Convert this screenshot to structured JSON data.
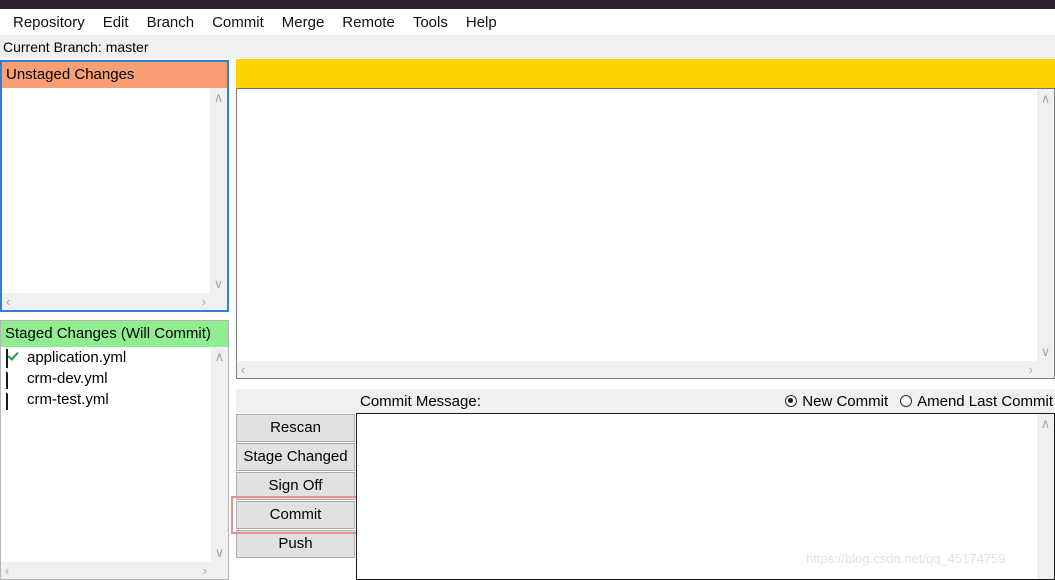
{
  "window": {
    "titlebar_color": "#2b1e2e"
  },
  "menubar": {
    "items": [
      {
        "label": "Repository"
      },
      {
        "label": "Edit"
      },
      {
        "label": "Branch"
      },
      {
        "label": "Commit"
      },
      {
        "label": "Merge"
      },
      {
        "label": "Remote"
      },
      {
        "label": "Tools"
      },
      {
        "label": "Help"
      }
    ]
  },
  "branch_bar": {
    "text": "Current Branch: master"
  },
  "unstaged": {
    "header": "Unstaged Changes",
    "header_color": "#fa9e73",
    "files": []
  },
  "staged": {
    "header": "Staged Changes (Will Commit)",
    "header_color": "#90ee90",
    "files": [
      {
        "name": "application.yml",
        "icon": "checked-box-icon",
        "state": "checked"
      },
      {
        "name": "crm-dev.yml",
        "icon": "document-icon",
        "state": "plain"
      },
      {
        "name": "crm-test.yml",
        "icon": "document-icon",
        "state": "plain"
      }
    ]
  },
  "diff": {
    "banner_color": "#ffd400",
    "banner_text": "",
    "content": ""
  },
  "commit": {
    "message_label": "Commit Message:",
    "message_value": "",
    "radios": [
      {
        "label": "New Commit",
        "selected": true
      },
      {
        "label": "Amend Last Commit",
        "selected": false
      }
    ]
  },
  "buttons": {
    "items": [
      {
        "label": "Rescan",
        "highlighted": false
      },
      {
        "label": "Stage Changed",
        "highlighted": false
      },
      {
        "label": "Sign Off",
        "highlighted": false
      },
      {
        "label": "Commit",
        "highlighted": true
      },
      {
        "label": "Push",
        "highlighted": false
      }
    ],
    "highlight_color": "#e8908f"
  },
  "scrollbar": {
    "arrow_up": "∧",
    "arrow_down": "∨",
    "arrow_left": "‹",
    "arrow_right": "›"
  },
  "watermark": {
    "text": "https://blog.csdn.net/qq_45174759"
  }
}
